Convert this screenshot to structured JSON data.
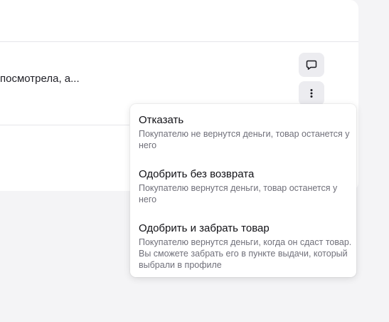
{
  "row": {
    "text": "посмотрела, а..."
  },
  "actions": {
    "chat_icon": "chat-bubble-icon",
    "more_icon": "more-vertical-icon"
  },
  "menu": {
    "items": [
      {
        "title": "Отказать",
        "description": "Покупателю не вернутся деньги, товар останется у него"
      },
      {
        "title": "Одобрить без возврата",
        "description": "Покупателю вернутся деньги, товар останется у него"
      },
      {
        "title": "Одобрить и забрать товар",
        "description": "Покупателю вернутся деньги, когда он сдаст товар. Вы сможете забрать его в пункте выдачи, который выбрали в профиле"
      }
    ]
  }
}
